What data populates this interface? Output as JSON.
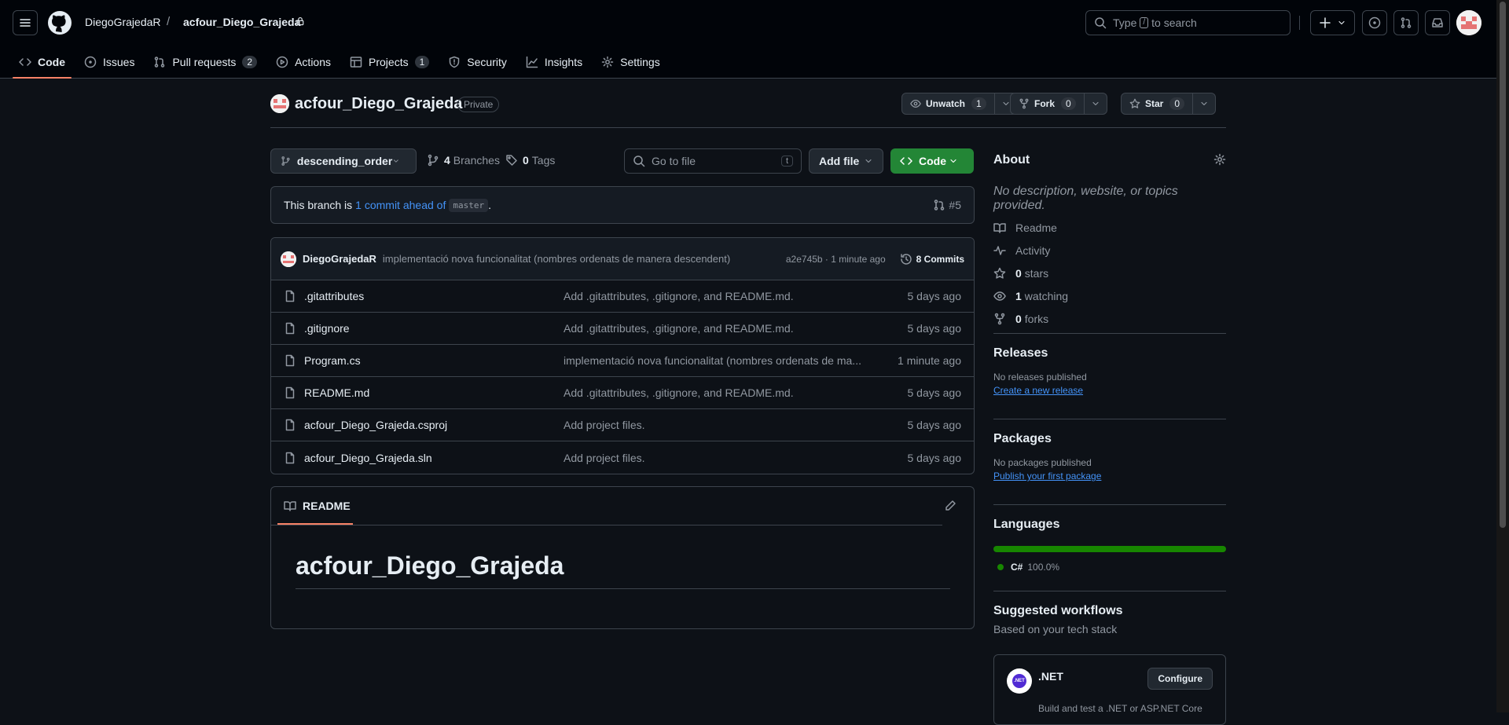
{
  "header": {
    "owner": "DiegoGrajedaR",
    "separator": "/",
    "repo": "acfour_Diego_Grajeda",
    "search_prefix": "Type",
    "search_key": "/",
    "search_suffix": "to search"
  },
  "tabs": [
    {
      "label": "Code",
      "icon": "code-icon",
      "active": true
    },
    {
      "label": "Issues",
      "icon": "issue-icon"
    },
    {
      "label": "Pull requests",
      "icon": "pull-request-icon",
      "count": "2"
    },
    {
      "label": "Actions",
      "icon": "play-icon"
    },
    {
      "label": "Projects",
      "icon": "table-icon",
      "count": "1"
    },
    {
      "label": "Security",
      "icon": "shield-icon"
    },
    {
      "label": "Insights",
      "icon": "graph-icon"
    },
    {
      "label": "Settings",
      "icon": "gear-icon"
    }
  ],
  "repo": {
    "name": "acfour_Diego_Grajeda",
    "visibility": "Private",
    "unwatch_label": "Unwatch",
    "watch_count": "1",
    "fork_label": "Fork",
    "fork_count": "0",
    "star_label": "Star",
    "star_count": "0"
  },
  "toolbar": {
    "branch": "descending_order",
    "branches_count": "4",
    "branches_label": "Branches",
    "tags_count": "0",
    "tags_label": "Tags",
    "goto_placeholder": "Go to file",
    "goto_key": "t",
    "add_file": "Add file",
    "code": "Code"
  },
  "ahead": {
    "prefix": "This branch is",
    "link": "1 commit ahead of",
    "base": "master",
    "suffix": ".",
    "pr": "#5"
  },
  "last_commit": {
    "author": "DiegoGrajedaR",
    "message": "implementació nova funcionalitat (nombres ordenats de manera descendent)",
    "sha_time": "a2e745b · 1 minute ago",
    "commits": "8 Commits"
  },
  "files": [
    {
      "name": ".gitattributes",
      "message": "Add .gitattributes, .gitignore, and README.md.",
      "date": "5 days ago"
    },
    {
      "name": ".gitignore",
      "message": "Add .gitattributes, .gitignore, and README.md.",
      "date": "5 days ago"
    },
    {
      "name": "Program.cs",
      "message": "implementació nova funcionalitat (nombres ordenats de ma...",
      "date": "1 minute ago"
    },
    {
      "name": "README.md",
      "message": "Add .gitattributes, .gitignore, and README.md.",
      "date": "5 days ago"
    },
    {
      "name": "acfour_Diego_Grajeda.csproj",
      "message": "Add project files.",
      "date": "5 days ago"
    },
    {
      "name": "acfour_Diego_Grajeda.sln",
      "message": "Add project files.",
      "date": "5 days ago"
    }
  ],
  "readme": {
    "tab": "README",
    "heading": "acfour_Diego_Grajeda"
  },
  "about": {
    "title": "About",
    "description": "No description, website, or topics provided.",
    "readme": "Readme",
    "activity": "Activity",
    "stars_count": "0",
    "stars_label": "stars",
    "watching_count": "1",
    "watching_label": "watching",
    "forks_count": "0",
    "forks_label": "forks"
  },
  "releases": {
    "title": "Releases",
    "status": "No releases published",
    "link": "Create a new release"
  },
  "packages": {
    "title": "Packages",
    "status": "No packages published",
    "link": "Publish your first package"
  },
  "languages": {
    "title": "Languages",
    "items": [
      {
        "name": "C#",
        "percent": "100.0%",
        "color": "#178600"
      }
    ]
  },
  "workflows": {
    "title": "Suggested workflows",
    "subtitle": "Based on your tech stack",
    "card_logo": ".NET",
    "card_title": ".NET",
    "configure": "Configure",
    "card_desc": "Build and test a .NET or ASP.NET Core"
  },
  "colors": {
    "accent": "#f78166",
    "link": "#4493f8",
    "primary_button": "#238636"
  }
}
